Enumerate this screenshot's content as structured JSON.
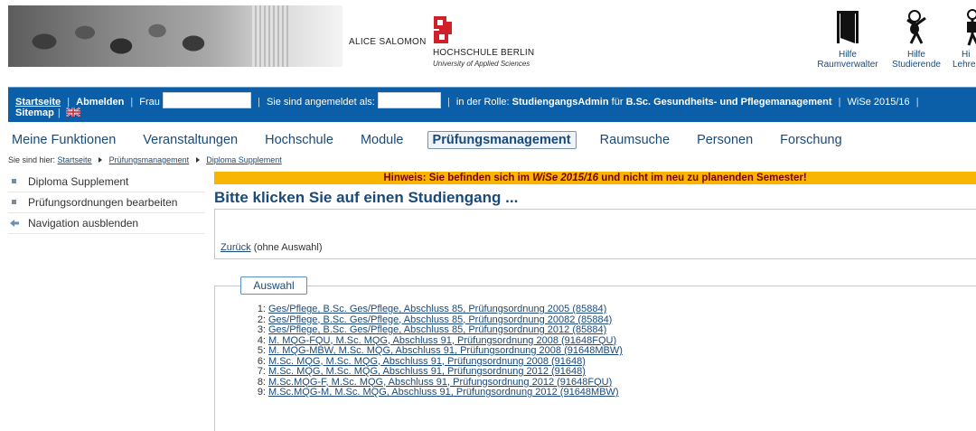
{
  "header": {
    "logo_left": "ALICE SALOMON",
    "logo_right_line1": "HOCHSCHULE BERLIN",
    "logo_right_line2": "University of Applied Sciences",
    "help_tiles": [
      {
        "line1": "Hilfe",
        "line2": "Raumverwalter",
        "icon": "door-icon"
      },
      {
        "line1": "Hilfe",
        "line2": "Studierende",
        "icon": "student-figure-icon"
      },
      {
        "line1": "Hi",
        "line2": "Lehre",
        "icon": "lecturer-figure-icon"
      }
    ]
  },
  "bluebar": {
    "startseite": "Startseite",
    "abmelden": "Abmelden",
    "frau": "Frau",
    "angemeldet": "Sie sind angemeldet als:",
    "rolle_prefix": "in der Rolle:",
    "rolle": "StudiengangsAdmin",
    "fuer": "für",
    "studiengang": "B.Sc. Gesundheits- und Pflegemanagement",
    "semester": "WiSe 2015/16",
    "sitemap": "Sitemap"
  },
  "topnav": [
    {
      "label": "Meine Funktionen",
      "active": false
    },
    {
      "label": "Veranstaltungen",
      "active": false
    },
    {
      "label": "Hochschule",
      "active": false
    },
    {
      "label": "Module",
      "active": false
    },
    {
      "label": "Prüfungsmanagement",
      "active": true
    },
    {
      "label": "Raumsuche",
      "active": false
    },
    {
      "label": "Personen",
      "active": false
    },
    {
      "label": "Forschung",
      "active": false
    }
  ],
  "breadcrumb": {
    "prefix": "Sie sind hier:",
    "items": [
      "Startseite",
      "Prüfungsmanagement",
      "Diploma Supplement"
    ]
  },
  "sidebar": {
    "items": [
      {
        "label": "Diploma Supplement",
        "icon": "square-bullet-icon"
      },
      {
        "label": "Prüfungsordnungen bearbeiten",
        "icon": "square-bullet-icon"
      },
      {
        "label": "Navigation ausblenden",
        "icon": "arrow-left-icon"
      }
    ]
  },
  "notice": {
    "prefix": "Hinweis: Sie befinden sich im",
    "semester": "WiSe 2015/16",
    "suffix": "und nicht im neu zu planenden Semester!"
  },
  "main": {
    "title": "Bitte klicken Sie auf einen Studiengang ...",
    "back_link": "Zurück",
    "back_note": "(ohne Auswahl)",
    "legend": "Auswahl",
    "items": [
      {
        "num": "1:",
        "label": "Ges/Pflege, B.Sc. Ges/Pflege, Abschluss 85, Prüfungsordnung 2005 (85884)"
      },
      {
        "num": "2:",
        "label": "Ges/Pflege, B.Sc. Ges/Pflege, Abschluss 85, Prüfungsordnung 20082 (85884)"
      },
      {
        "num": "3:",
        "label": "Ges/Pflege, B.Sc. Ges/Pflege, Abschluss 85, Prüfungsordnung 2012 (85884)"
      },
      {
        "num": "4:",
        "label": "M. MQG-FQU, M.Sc. MQG, Abschluss 91, Prüfungsordnung 2008 (91648FQU)"
      },
      {
        "num": "5:",
        "label": "M. MQG-MBW, M.Sc. MQG, Abschluss 91, Prüfungsordnung 2008 (91648MBW)"
      },
      {
        "num": "6:",
        "label": "M.Sc. MQG, M.Sc. MQG, Abschluss 91, Prüfungsordnung 2008 (91648)"
      },
      {
        "num": "7:",
        "label": "M.Sc. MQG, M.Sc. MQG, Abschluss 91, Prüfungsordnung 2012 (91648)"
      },
      {
        "num": "8:",
        "label": "M.Sc.MQG-F, M.Sc. MQG, Abschluss 91, Prüfungsordnung 2012 (91648FQU)"
      },
      {
        "num": "9:",
        "label": "M.Sc.MQG-M, M.Sc. MQG, Abschluss 91, Prüfungsordnung 2012 (91648MBW)"
      }
    ]
  },
  "colors": {
    "bluebar": "#0a5fa8",
    "notice_bg": "#f7b500",
    "notice_text": "#7a0000",
    "link": "#1a4a7a",
    "logo_red": "#d0202a"
  }
}
